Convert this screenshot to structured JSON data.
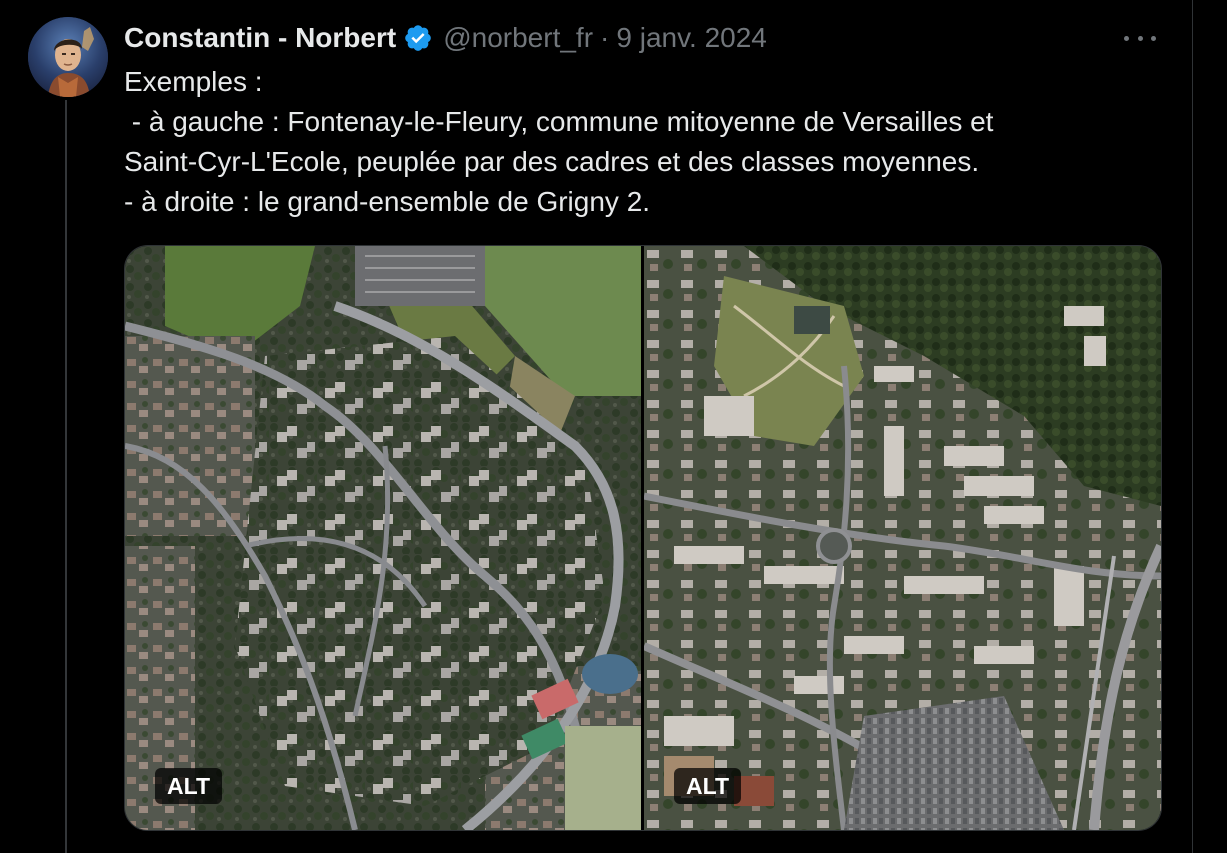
{
  "tweet": {
    "author_name": "Constantin - Norbert",
    "handle": "@norbert_fr",
    "separator": "·",
    "date": "9 janv. 2024",
    "text_lines": [
      "Exemples :",
      " - à gauche : Fontenay-le-Fleury, commune mitoyenne de Versailles et",
      "Saint-Cyr-L'Ecole, peuplée par des cadres et des classes moyennes.",
      "- à droite : le grand-ensemble de Grigny 2."
    ]
  },
  "media": {
    "left": {
      "alt_label": "ALT"
    },
    "right": {
      "alt_label": "ALT"
    }
  },
  "icons": {
    "verified": "verified-badge-icon",
    "more": "more-options-icon"
  },
  "colors": {
    "background": "#000000",
    "text_primary": "#e7e9ea",
    "text_secondary": "#71767b",
    "verified_blue": "#1d9bf0",
    "border": "#2f3336"
  }
}
